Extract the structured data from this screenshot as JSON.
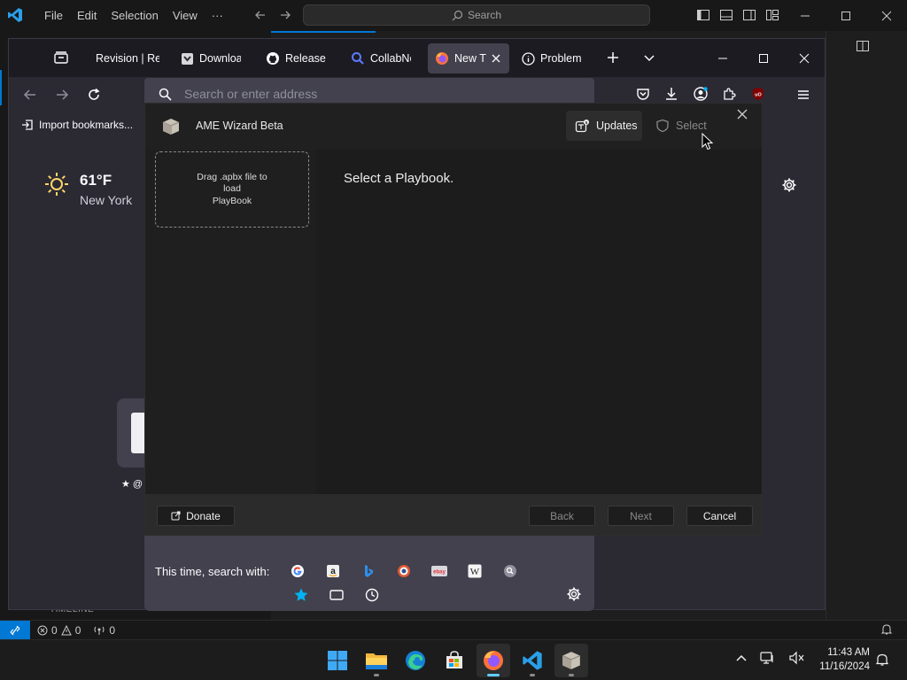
{
  "vscode": {
    "menu": [
      "File",
      "Edit",
      "Selection",
      "View",
      "···"
    ],
    "search_label": "Search",
    "timeline_label": "TIMELINE",
    "status": {
      "errors": "0",
      "warnings": "0",
      "ports": "0"
    }
  },
  "firefox": {
    "tabs": [
      {
        "label": "Revision | Rev",
        "icon": "revision-icon"
      },
      {
        "label": "Downloa",
        "icon": "pocket-download-icon"
      },
      {
        "label": "Release A",
        "icon": "github-icon"
      },
      {
        "label": "CollabNe",
        "icon": "search-tab-icon"
      },
      {
        "label": "New T",
        "icon": "firefox-icon",
        "active": true
      },
      {
        "label": "Problem",
        "icon": "info-icon"
      }
    ],
    "url_placeholder": "Search or enter address",
    "bookmarks_import": "Import bookmarks...",
    "weather": {
      "temperature": "61°F",
      "city": "New York"
    },
    "shortcut_label": "★ @",
    "search_with_label": "This time, search with:",
    "search_engines": [
      "google",
      "amazon",
      "bing",
      "duckduckgo",
      "ebay",
      "wikipedia",
      "other"
    ]
  },
  "ame": {
    "title": "AME Wizard Beta",
    "updates_label": "Updates",
    "select_label": "Select",
    "drop_text_line1": "Drag .apbx file to",
    "drop_text_line2": "load",
    "drop_text_line3": "PlayBook",
    "main_title": "Select a Playbook.",
    "donate_label": "Donate",
    "back_label": "Back",
    "next_label": "Next",
    "cancel_label": "Cancel"
  },
  "taskbar": {
    "apps": [
      "start",
      "file-explorer",
      "edge",
      "store",
      "firefox",
      "vscode",
      "ame-wizard"
    ],
    "time": "11:43 AM",
    "date": "11/16/2024"
  },
  "colors": {
    "vscode_accent": "#0078d4",
    "firefox_bg": "#2b2a33",
    "ame_bg": "#1c1c1c",
    "taskbar_indicator": "#60cdff"
  }
}
